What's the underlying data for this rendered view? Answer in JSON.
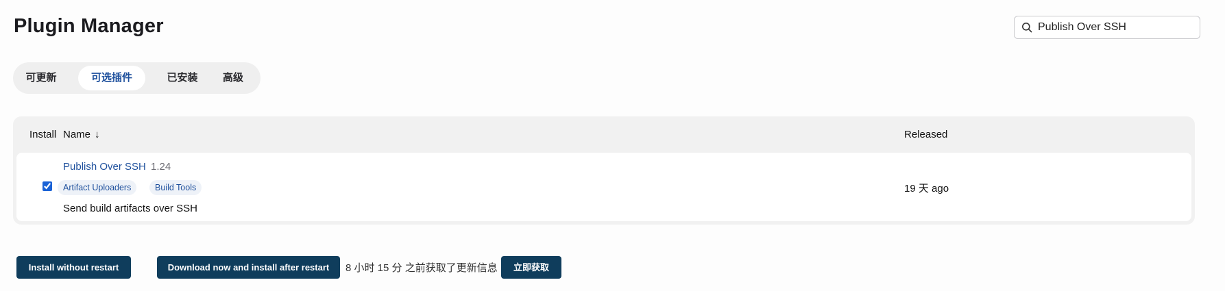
{
  "header": {
    "title": "Plugin Manager"
  },
  "search": {
    "value": "Publish Over SSH",
    "icon": "search-icon"
  },
  "tabs": [
    {
      "label": "可更新",
      "active": false
    },
    {
      "label": "可选插件",
      "active": true
    },
    {
      "label": "已安装",
      "active": false
    },
    {
      "label": "高级",
      "active": false
    }
  ],
  "table": {
    "columns": {
      "install": "Install",
      "name": "Name",
      "sort_indicator": "↓",
      "released": "Released"
    },
    "rows": [
      {
        "checked": true,
        "name": "Publish Over SSH",
        "version": "1.24",
        "tags": [
          "Artifact Uploaders",
          "Build Tools"
        ],
        "description": "Send build artifacts over SSH",
        "released": "19 天 ago"
      }
    ]
  },
  "actions": {
    "install_without_restart": "Install without restart",
    "download_install_after_restart": "Download now and install after restart",
    "update_info": "8 小时 15 分 之前获取了更新信息",
    "check_now": "立即获取"
  },
  "colors": {
    "accent": "#1d4f9c",
    "button_bg": "#0f3d5c",
    "panel_bg": "#f1f1f1",
    "tabbar_bg": "#efefef"
  }
}
